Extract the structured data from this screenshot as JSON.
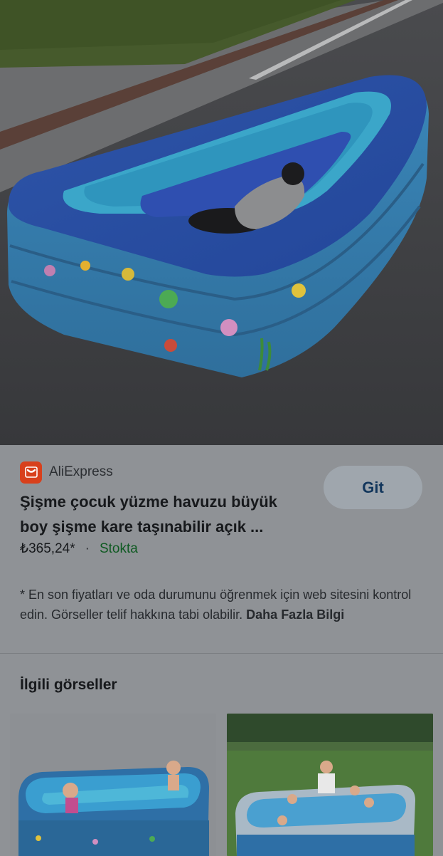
{
  "hero": {
    "icon": "inflatable-pool-photo"
  },
  "source": {
    "name": "AliExpress",
    "logo_icon": "aliexpress-bag-icon",
    "logo_color": "#d8401c"
  },
  "product": {
    "title_line1": "Şişme çocuk yüzme havuzu büyük",
    "title_line2": "boy şişme kare taşınabilir açık ...",
    "price": "₺365,24*",
    "separator": "·",
    "stock": "Stokta"
  },
  "actions": {
    "go_label": "Git"
  },
  "disclaimer": {
    "text": "* En son fiyatları ve oda durumunu öğrenmek için web sitesini kontrol edin. Görseller telif hakkına tabi olabilir.",
    "more_label": "Daha Fazla Bilgi"
  },
  "related": {
    "title": "İlgili görseller",
    "thumbnails": [
      {
        "icon": "pool-with-children-photo"
      },
      {
        "icon": "pool-on-lawn-photo"
      }
    ]
  },
  "colors": {
    "accent_text": "#12365c",
    "stock_green": "#0f5a22",
    "panel_bg": "#8f9296"
  }
}
